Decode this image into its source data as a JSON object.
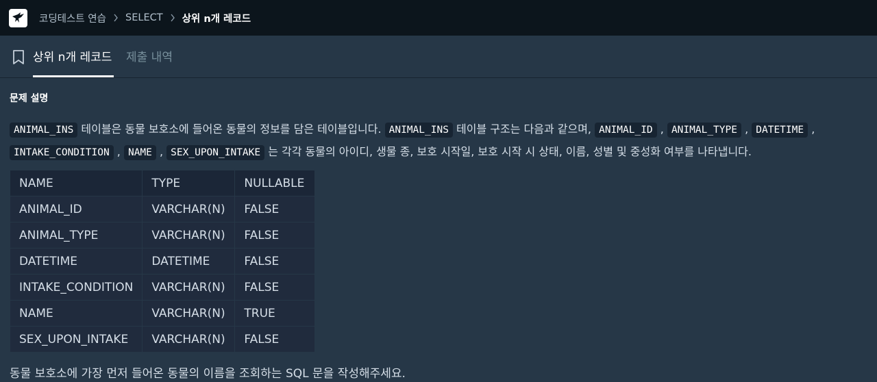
{
  "header": {
    "breadcrumb": [
      "코딩테스트 연습",
      "SELECT",
      "상위 n개 레코드"
    ]
  },
  "tabs": [
    {
      "label": "상위 n개 레코드",
      "active": true
    },
    {
      "label": "제출 내역",
      "active": false
    }
  ],
  "section_title": "문제 설명",
  "description": {
    "t1": " 테이블은 동물 보호소에 들어온 동물의 정보를 담은 테이블입니다. ",
    "t2": " 테이블 구조는 다음과 같으며, ",
    "t3": " 는 각각 동물의 아이디, 생물 종, 보호 시작일, 보호 시작 시 상태, 이름, 성별 및 중성화 여부를 나타냅니다.",
    "codes": [
      "ANIMAL_INS",
      "ANIMAL_INS",
      "ANIMAL_ID",
      "ANIMAL_TYPE",
      "DATETIME",
      "INTAKE_CONDITION",
      "NAME",
      "SEX_UPON_INTAKE"
    ],
    "comma": ","
  },
  "table": {
    "headers": [
      "NAME",
      "TYPE",
      "NULLABLE"
    ],
    "rows": [
      [
        "ANIMAL_ID",
        "VARCHAR(N)",
        "FALSE"
      ],
      [
        "ANIMAL_TYPE",
        "VARCHAR(N)",
        "FALSE"
      ],
      [
        "DATETIME",
        "DATETIME",
        "FALSE"
      ],
      [
        "INTAKE_CONDITION",
        "VARCHAR(N)",
        "FALSE"
      ],
      [
        "NAME",
        "VARCHAR(N)",
        "TRUE"
      ],
      [
        "SEX_UPON_INTAKE",
        "VARCHAR(N)",
        "FALSE"
      ]
    ]
  },
  "question": "동물 보호소에 가장 먼저 들어온 동물의 이름을 조회하는 SQL 문을 작성해주세요.",
  "icons": {
    "logo": "programmers-bird-logo-icon",
    "separator": "chevron-right-icon",
    "bookmark": "bookmark-icon"
  },
  "colors": {
    "topbar": "#0c151c",
    "background": "#263747",
    "table_cell": "#202b3d",
    "code_bg": "#172432"
  }
}
